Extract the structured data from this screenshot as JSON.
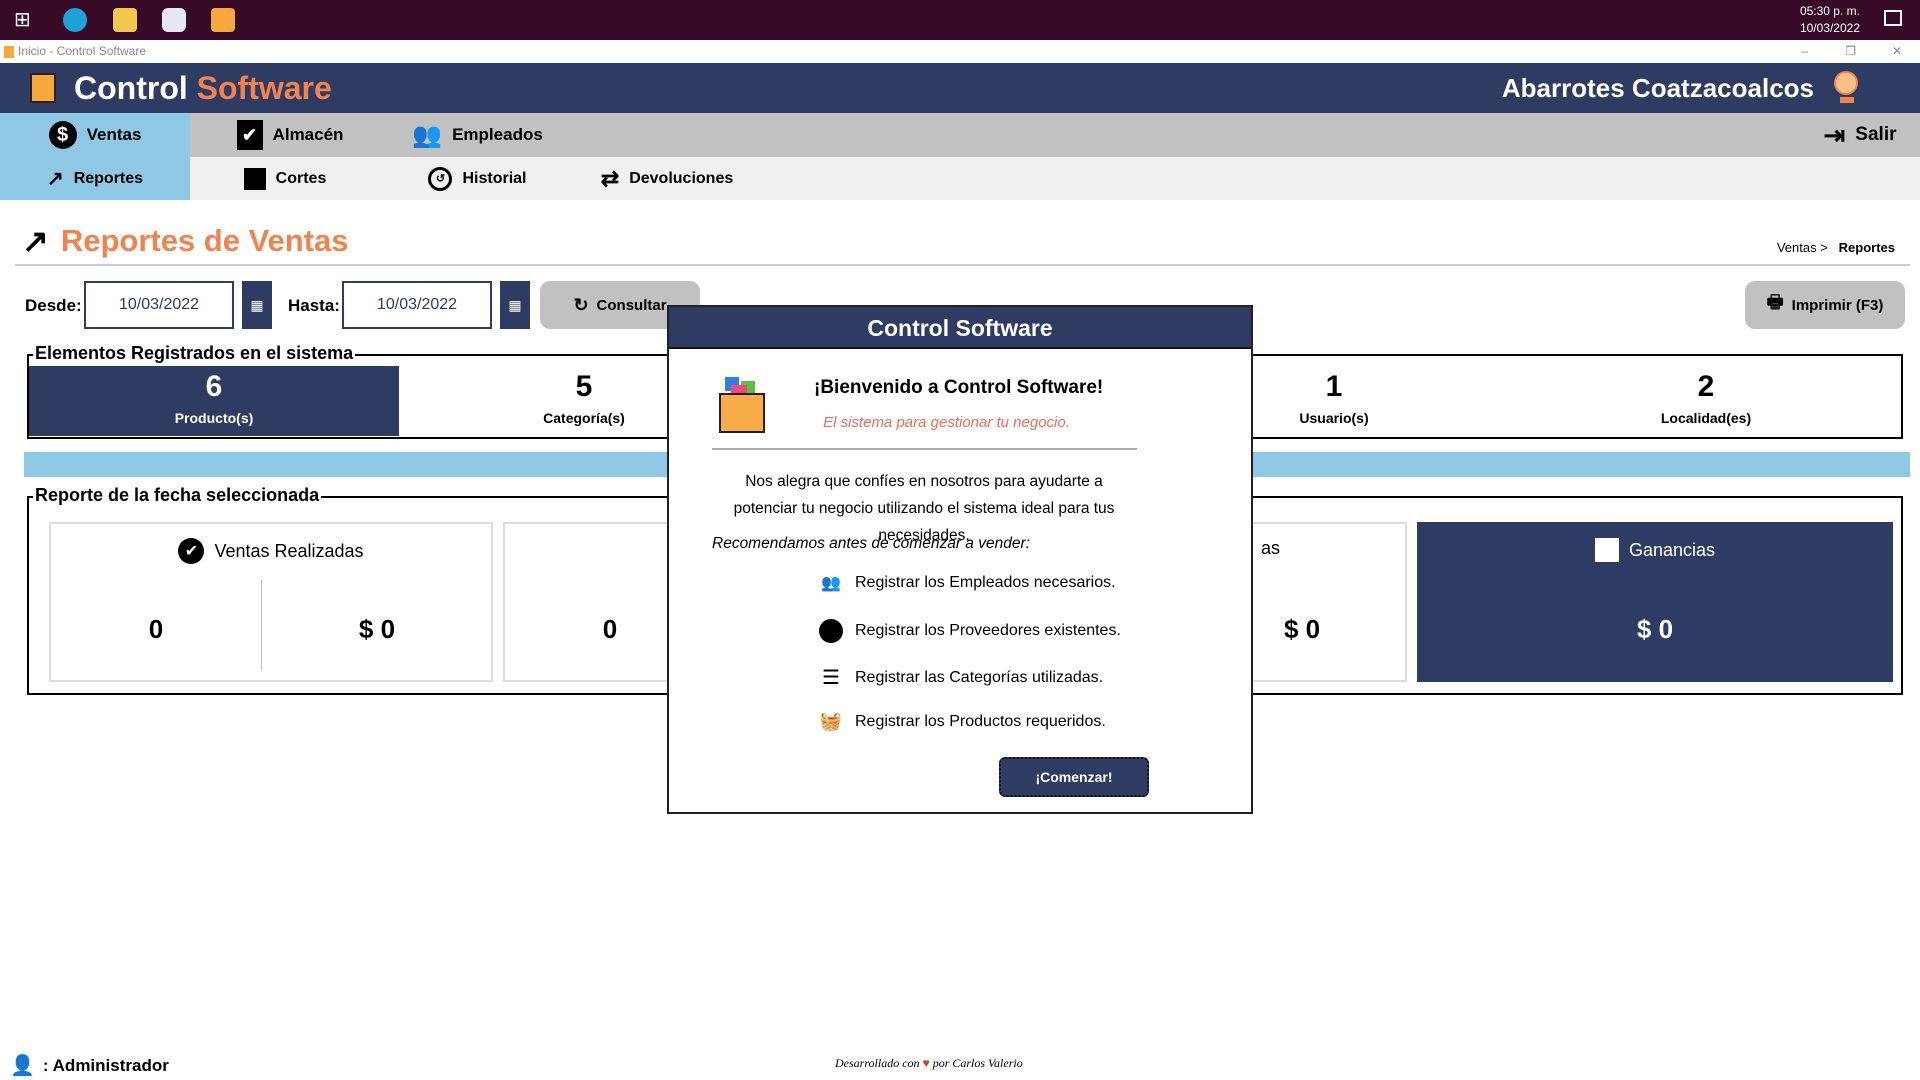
{
  "taskbar": {
    "time": "05:30 p. m.",
    "date": "10/03/2022"
  },
  "window": {
    "title": "Inicio - Control Software",
    "minimize": "–",
    "restore": "❐",
    "close": "✕"
  },
  "header": {
    "brand_part1": "Control",
    "brand_part2": "Software",
    "store_name": "Abarrotes Coatzacoalcos",
    "brand_color": "#2e3b62",
    "accent_color": "#f0834f"
  },
  "nav": {
    "main": [
      {
        "label": "Ventas",
        "icon": "dollar-circle-icon",
        "active": true
      },
      {
        "label": "Almacén",
        "icon": "clipboard-check-icon"
      },
      {
        "label": "Empleados",
        "icon": "users-icon"
      }
    ],
    "exit": "Salir",
    "sub": [
      {
        "label": "Reportes",
        "icon": "trend-icon",
        "active": true
      },
      {
        "label": "Cortes",
        "icon": "cash-register-icon"
      },
      {
        "label": "Historial",
        "icon": "history-icon"
      },
      {
        "label": "Devoluciones",
        "icon": "exchange-icon"
      }
    ]
  },
  "page": {
    "title": "Reportes de Ventas",
    "breadcrumb_parent": "Ventas >",
    "breadcrumb_current": "Reportes"
  },
  "filters": {
    "from_label": "Desde:",
    "from_value": "10/03/2022",
    "to_label": "Hasta:",
    "to_value": "10/03/2022",
    "query_button": "Consultar",
    "print_button": "Imprimir (F3)"
  },
  "registered": {
    "title": "Elementos Registrados en el sistema",
    "items": [
      {
        "value": "6",
        "label": "Producto(s)"
      },
      {
        "value": "5",
        "label": "Categoría(s)"
      },
      {
        "value": "",
        "label": ""
      },
      {
        "value": "1",
        "label": "Usuario(s)"
      },
      {
        "value": "2",
        "label": "Localidad(es)"
      }
    ]
  },
  "report": {
    "title": "Reporte de la fecha seleccionada",
    "cards": [
      {
        "title": "Ventas Realizadas",
        "count": "0",
        "amount": "$ 0"
      },
      {
        "title": "",
        "count": "0"
      },
      {
        "title": "as",
        "amount": "$ 0"
      },
      {
        "title": "Ganancias",
        "amount": "$ 0"
      }
    ]
  },
  "dialog": {
    "title": "Control Software",
    "heading": "¡Bienvenido a Control Software!",
    "subtitle": "El sistema para gestionar tu negocio.",
    "body": "Nos alegra que confíes en nosotros para ayudarte a potenciar tu negocio utilizando el sistema ideal para tus necesidades.",
    "recommend": "Recomendamos antes de comenzar a vender:",
    "items": [
      "Registrar los Empleados necesarios.",
      "Registrar los Proveedores existentes.",
      "Registrar las Categorías utilizadas.",
      "Registrar los Productos requeridos."
    ],
    "start_button": "¡Comenzar!"
  },
  "footer": {
    "user": ": Administrador",
    "credit_prefix": "Desarrollado con",
    "credit_suffix": "por Carlos Valerio",
    "heart_color": "#d9341c"
  }
}
